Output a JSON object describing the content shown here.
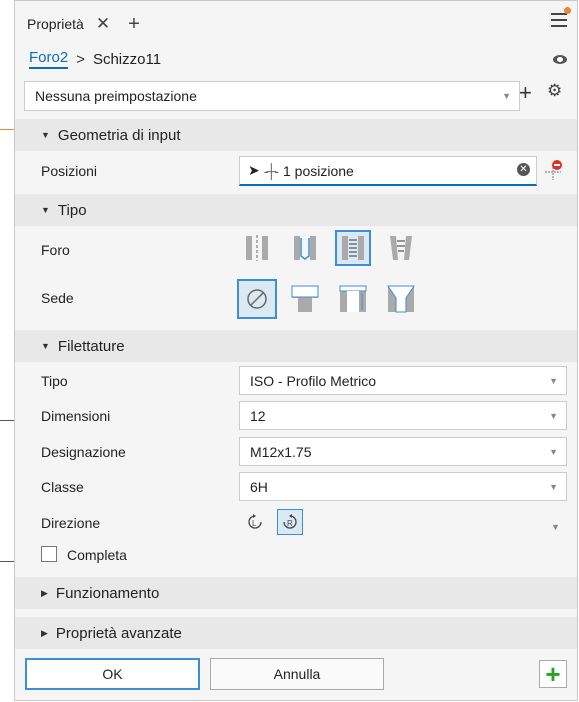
{
  "tab": {
    "title": "Proprietà",
    "close": "✕",
    "add": "+"
  },
  "breadcrumb": {
    "feature": "Foro2",
    "separator": ">",
    "sketch": "Schizzo11"
  },
  "preset": {
    "value": "Nessuna preimpostazione"
  },
  "sections": {
    "geometry": "Geometria di input",
    "type": "Tipo",
    "threads": "Filettature",
    "behavior": "Funzionamento",
    "advanced": "Proprietà avanzate"
  },
  "geometry": {
    "positions_label": "Posizioni",
    "positions_value": "1 posizione"
  },
  "type": {
    "hole_label": "Foro",
    "seat_label": "Sede"
  },
  "threads": {
    "type_label": "Tipo",
    "type_value": "ISO - Profilo  Metrico",
    "size_label": "Dimensioni",
    "size_value": "12",
    "designation_label": "Designazione",
    "designation_value": "M12x1.75",
    "class_label": "Classe",
    "class_value": "6H",
    "direction_label": "Direzione",
    "full_label": "Completa"
  },
  "buttons": {
    "ok": "OK",
    "cancel": "Annulla"
  },
  "colors": {
    "accent": "#3c8ed6",
    "link": "#0a6fb8",
    "orange": "#e8863a",
    "green": "#2aa02a"
  }
}
